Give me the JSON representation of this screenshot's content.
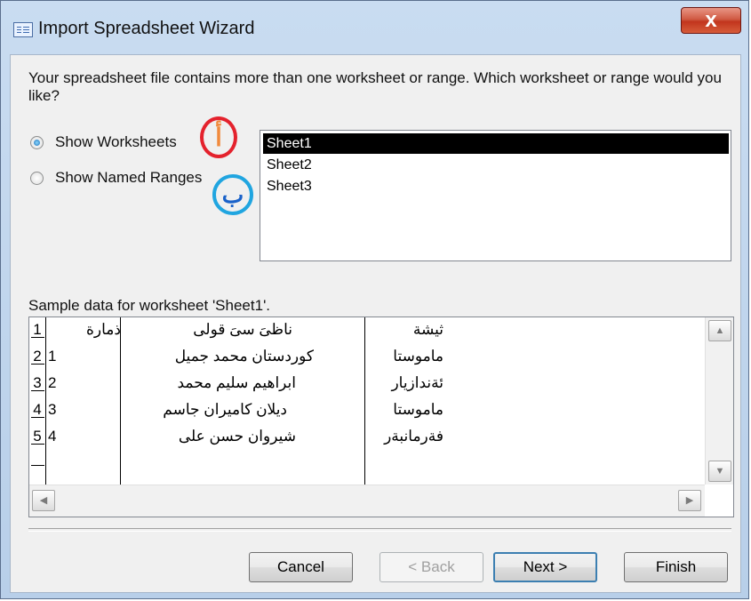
{
  "window": {
    "title": "Import Spreadsheet Wizard",
    "close_glyph": "x",
    "app_icon": "table-icon"
  },
  "prompt": "Your spreadsheet file contains more than one worksheet or range. Which worksheet or range would you like?",
  "options": {
    "worksheets_label": "Show Worksheets",
    "named_ranges_label": "Show Named Ranges",
    "selected": "worksheets"
  },
  "annotations": {
    "a_letter": "أ",
    "b_letter": "ب",
    "a_color": "#e4222d",
    "b_color": "#20a5e0"
  },
  "sheets": [
    "Sheet1",
    "Sheet2",
    "Sheet3"
  ],
  "selected_sheet": "Sheet1",
  "sample_label": "Sample data for worksheet 'Sheet1'.",
  "sample_table": {
    "rows": [
      {
        "n": "1",
        "c1": "ذمارة",
        "c2": "ناظىَ سىَ قولى",
        "c3": "ثيشة"
      },
      {
        "n": "2",
        "c1": "1",
        "c2": "كوردستان محمد جميل",
        "c3": "ماموستا"
      },
      {
        "n": "3",
        "c1": "2",
        "c2": "ابراهيم سليم محمد",
        "c3": "ئةندازيار"
      },
      {
        "n": "4",
        "c1": "3",
        "c2": "ديلان كاميران جاسم",
        "c3": "ماموستا"
      },
      {
        "n": "5",
        "c1": "4",
        "c2": "شيروان حسن على",
        "c3": "فةرمانبةر"
      }
    ]
  },
  "buttons": {
    "cancel": "Cancel",
    "back": "< Back",
    "next": "Next >",
    "finish": "Finish"
  }
}
